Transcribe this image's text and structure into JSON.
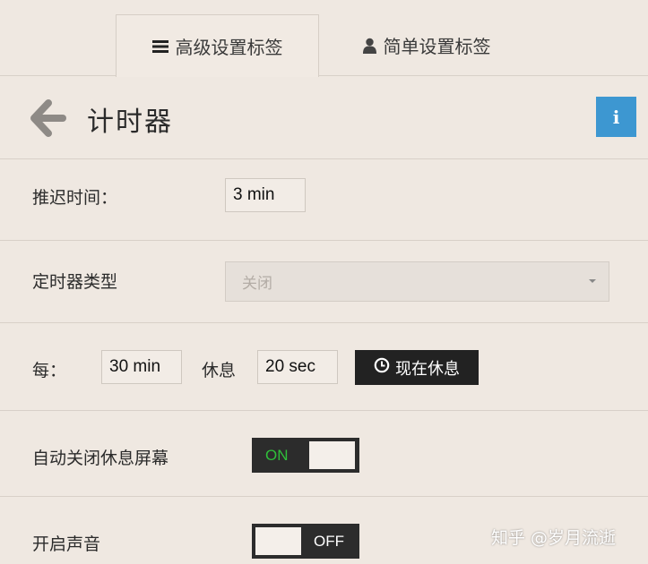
{
  "tabs": [
    {
      "label": "高级设置标签",
      "icon": "menu-icon",
      "active": true
    },
    {
      "label": "简单设置标签",
      "icon": "user-icon",
      "active": false
    }
  ],
  "header": {
    "title": "计时器",
    "back_icon": "back-arrow-icon",
    "info_label": "i"
  },
  "delay": {
    "label": "推迟时间：",
    "value": "3 min"
  },
  "timer_type": {
    "label": "定时器类型",
    "selected": "关闭"
  },
  "interval": {
    "label": "每：",
    "every_value": "30 min",
    "rest_label": "休息",
    "rest_value": "20 sec",
    "break_button_label": "现在休息"
  },
  "auto_close": {
    "label": "自动关闭休息屏幕",
    "toggle_text": "ON",
    "on": true
  },
  "sound": {
    "label": "开启声音",
    "toggle_text": "OFF",
    "on": false
  },
  "watermark": "知乎 @岁月流逝",
  "colors": {
    "background": "#efe8e1",
    "info_accent": "#3d97d1",
    "toggle_dark": "#2c2c2c",
    "toggle_on_text": "#2fbf3a",
    "toggle_off_text": "#ffffff"
  }
}
